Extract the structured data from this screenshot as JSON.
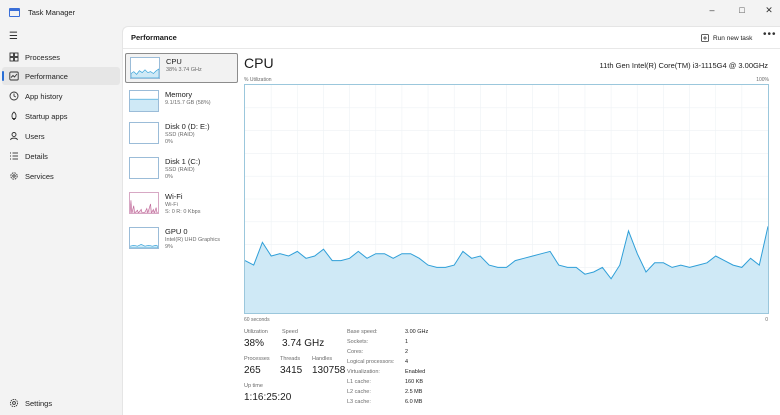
{
  "window": {
    "title": "Task Manager",
    "minimize": "–",
    "maximize": "□",
    "close": "✕"
  },
  "sidebar": {
    "items": [
      {
        "label": "Processes",
        "icon": "processes-icon"
      },
      {
        "label": "Performance",
        "icon": "performance-icon",
        "active": true
      },
      {
        "label": "App history",
        "icon": "history-icon"
      },
      {
        "label": "Startup apps",
        "icon": "startup-icon"
      },
      {
        "label": "Users",
        "icon": "users-icon"
      },
      {
        "label": "Details",
        "icon": "details-icon"
      },
      {
        "label": "Services",
        "icon": "services-icon"
      }
    ],
    "settings": "Settings"
  },
  "header": {
    "title": "Performance",
    "run_task": "Run new task",
    "more": "•••"
  },
  "devices": [
    {
      "name": "CPU",
      "sub1": "38% 3.74 GHz",
      "selected": true
    },
    {
      "name": "Memory",
      "sub1": "9.1/15.7 GB (58%)"
    },
    {
      "name": "Disk 0 (D: E:)",
      "sub1": "SSD (RAID)",
      "sub2": "0%"
    },
    {
      "name": "Disk 1 (C:)",
      "sub1": "SSD (RAID)",
      "sub2": "0%"
    },
    {
      "name": "Wi-Fi",
      "sub1": "Wi-Fi",
      "sub2": "S: 0 R: 0 Kbps"
    },
    {
      "name": "GPU 0",
      "sub1": "Intel(R) UHD Graphics",
      "sub2": "9%"
    }
  ],
  "detail": {
    "title": "CPU",
    "processor": "11th Gen Intel(R) Core(TM) i3-1115G4 @ 3.00GHz",
    "graph_ylabel": "% Utilization",
    "graph_ymax": "100%",
    "graph_xlabel": "60 seconds",
    "graph_ymin": "0",
    "stats": {
      "utilization_label": "Utilization",
      "utilization": "38%",
      "speed_label": "Speed",
      "speed": "3.74 GHz",
      "processes_label": "Processes",
      "processes": "265",
      "threads_label": "Threads",
      "threads": "3415",
      "handles_label": "Handles",
      "handles": "130758",
      "uptime_label": "Up time",
      "uptime": "1:16:25:20"
    },
    "specs": [
      {
        "label": "Base speed:",
        "value": "3.00 GHz"
      },
      {
        "label": "Sockets:",
        "value": "1"
      },
      {
        "label": "Cores:",
        "value": "2"
      },
      {
        "label": "Logical processors:",
        "value": "4"
      },
      {
        "label": "Virtualization:",
        "value": "Enabled"
      },
      {
        "label": "L1 cache:",
        "value": "160 KB"
      },
      {
        "label": "L2 cache:",
        "value": "2.5 MB"
      },
      {
        "label": "L3 cache:",
        "value": "6.0 MB"
      }
    ]
  },
  "colors": {
    "cpu_line": "#2f9fd8",
    "cpu_fill": "#cfe9f6",
    "wifi_line": "#c06a9a",
    "accent": "#2a6fd6"
  },
  "chart_data": {
    "type": "area",
    "x": [
      0,
      1,
      2,
      3,
      4,
      5,
      6,
      7,
      8,
      9,
      10,
      11,
      12,
      13,
      14,
      15,
      16,
      17,
      18,
      19,
      20,
      21,
      22,
      23,
      24,
      25,
      26,
      27,
      28,
      29,
      30,
      31,
      32,
      33,
      34,
      35,
      36,
      37,
      38,
      39,
      40,
      41,
      42,
      43,
      44,
      45,
      46,
      47,
      48,
      49,
      50,
      51,
      52,
      53,
      54,
      55,
      56,
      57,
      58,
      59,
      60
    ],
    "series": [
      {
        "values": [
          23,
          21,
          31,
          25,
          26,
          25,
          27,
          24,
          25,
          28,
          23,
          23,
          24,
          27,
          24,
          26,
          26,
          24,
          26,
          26,
          24,
          21,
          20,
          20,
          21,
          27,
          24,
          25,
          21,
          20,
          20,
          23,
          24,
          25,
          26,
          27,
          21,
          20,
          20,
          17,
          18,
          20,
          15,
          21,
          36,
          26,
          18,
          22,
          22,
          20,
          21,
          20,
          21,
          22,
          25,
          23,
          21,
          20,
          24,
          21,
          38
        ]
      }
    ],
    "ylim": [
      0,
      100
    ],
    "xlim": [
      0,
      60
    ]
  }
}
